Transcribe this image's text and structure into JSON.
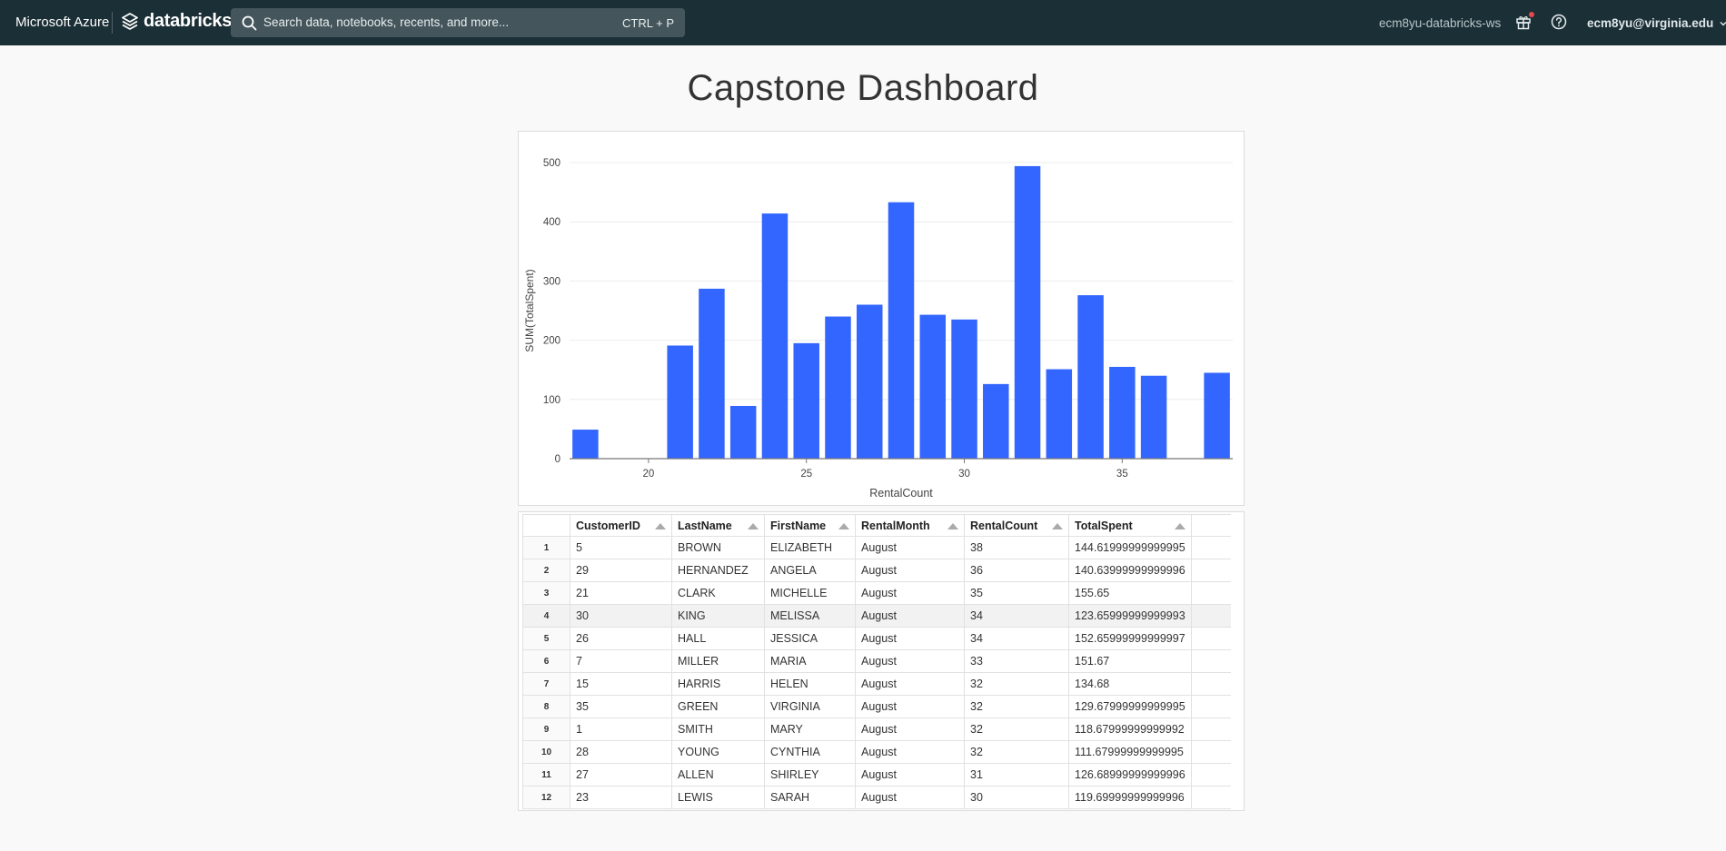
{
  "topbar": {
    "brand_ms": "Microsoft Azure",
    "brand_db": "databricks",
    "search_placeholder": "Search data, notebooks, recents, and more...",
    "search_shortcut": "CTRL + P",
    "workspace": "ecm8yu-databricks-ws",
    "user": "ecm8yu@virginia.edu",
    "icons": [
      "databricks-logo-icon",
      "search-icon",
      "gift-icon",
      "help-icon",
      "chevron-down-icon"
    ],
    "colors": {
      "bar": "#1b2f36",
      "notification": "#e5484d"
    }
  },
  "page_title": "Capstone Dashboard",
  "chart_data": {
    "type": "bar",
    "xlabel": "RentalCount",
    "ylabel": "SUM(TotalSpent)",
    "x_ticks": [
      20,
      25,
      30,
      35
    ],
    "y_ticks": [
      0,
      100,
      200,
      300,
      400,
      500
    ],
    "xlim": [
      17.5,
      38.5
    ],
    "ylim": [
      0,
      500
    ],
    "grid": true,
    "bar_color": "#3366ff",
    "x": [
      18,
      21,
      22,
      23,
      24,
      25,
      26,
      27,
      28,
      29,
      30,
      31,
      32,
      33,
      34,
      35,
      36,
      38
    ],
    "values": [
      49,
      191,
      287,
      89,
      414,
      195,
      240,
      260,
      433,
      243,
      235,
      126,
      494,
      151,
      276,
      155,
      140,
      145
    ]
  },
  "table": {
    "columns": [
      "CustomerID",
      "LastName",
      "FirstName",
      "RentalMonth",
      "RentalCount",
      "TotalSpent"
    ],
    "rows": [
      [
        "1",
        "5",
        "BROWN",
        "ELIZABETH",
        "August",
        "38",
        "144.61999999999995"
      ],
      [
        "2",
        "29",
        "HERNANDEZ",
        "ANGELA",
        "August",
        "36",
        "140.63999999999996"
      ],
      [
        "3",
        "21",
        "CLARK",
        "MICHELLE",
        "August",
        "35",
        "155.65"
      ],
      [
        "4",
        "30",
        "KING",
        "MELISSA",
        "August",
        "34",
        "123.65999999999993"
      ],
      [
        "5",
        "26",
        "HALL",
        "JESSICA",
        "August",
        "34",
        "152.65999999999997"
      ],
      [
        "6",
        "7",
        "MILLER",
        "MARIA",
        "August",
        "33",
        "151.67"
      ],
      [
        "7",
        "15",
        "HARRIS",
        "HELEN",
        "August",
        "32",
        "134.68"
      ],
      [
        "8",
        "35",
        "GREEN",
        "VIRGINIA",
        "August",
        "32",
        "129.67999999999995"
      ],
      [
        "9",
        "1",
        "SMITH",
        "MARY",
        "August",
        "32",
        "118.67999999999992"
      ],
      [
        "10",
        "28",
        "YOUNG",
        "CYNTHIA",
        "August",
        "32",
        "111.67999999999995"
      ],
      [
        "11",
        "27",
        "ALLEN",
        "SHIRLEY",
        "August",
        "31",
        "126.68999999999996"
      ],
      [
        "12",
        "23",
        "LEWIS",
        "SARAH",
        "August",
        "30",
        "119.69999999999996"
      ]
    ]
  }
}
